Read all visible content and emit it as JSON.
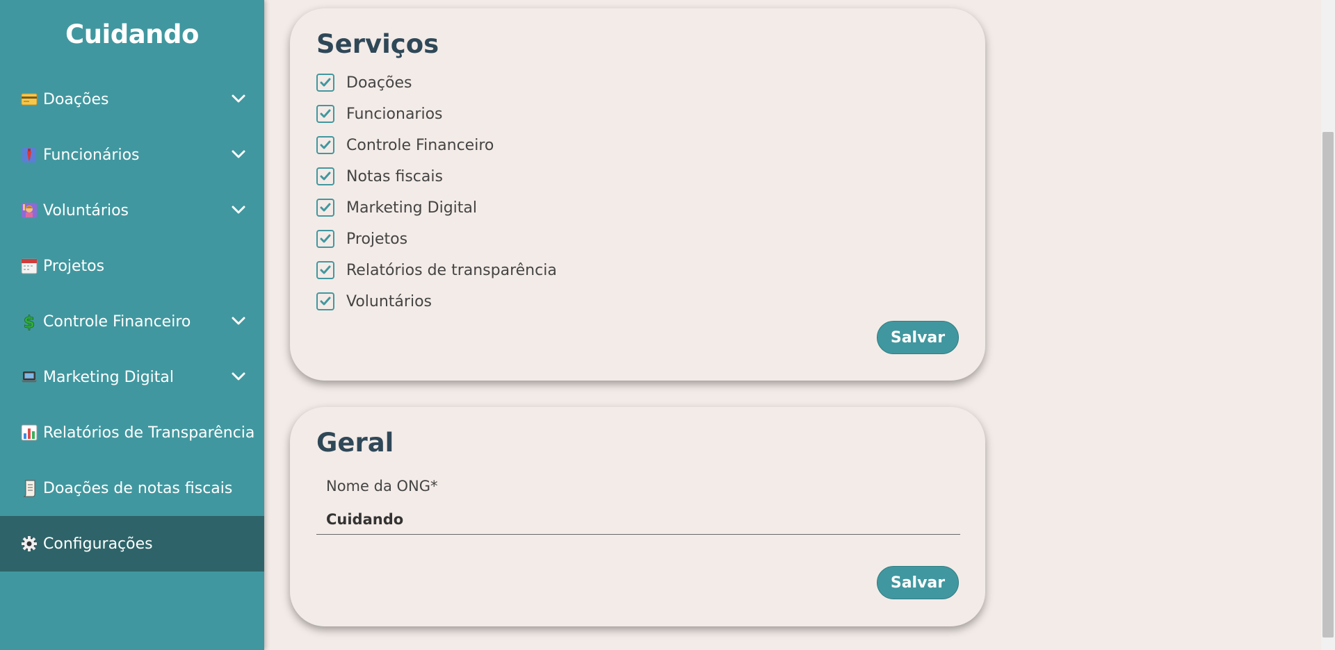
{
  "sidebar": {
    "brand": "Cuidando",
    "items": [
      {
        "label": "Doações",
        "icon": "credit-card-icon",
        "expandable": true
      },
      {
        "label": "Funcionários",
        "icon": "necktie-icon",
        "expandable": true
      },
      {
        "label": "Voluntários",
        "icon": "raising-hand-person-icon",
        "expandable": true
      },
      {
        "label": "Projetos",
        "icon": "calendar-icon",
        "expandable": false
      },
      {
        "label": "Controle Financeiro",
        "icon": "dollar-sign-icon",
        "expandable": true
      },
      {
        "label": "Marketing Digital",
        "icon": "laptop-icon",
        "expandable": true
      },
      {
        "label": "Relatórios de Transparência",
        "icon": "bar-chart-icon",
        "expandable": false
      },
      {
        "label": "Doações de notas fiscais",
        "icon": "receipt-scroll-icon",
        "expandable": false
      },
      {
        "label": "Configurações",
        "icon": "gear-icon",
        "expandable": false,
        "active": true
      }
    ]
  },
  "services": {
    "title": "Serviços",
    "items": [
      {
        "label": "Doações",
        "checked": true
      },
      {
        "label": "Funcionarios",
        "checked": true
      },
      {
        "label": "Controle Financeiro",
        "checked": true
      },
      {
        "label": "Notas fiscais",
        "checked": true
      },
      {
        "label": "Marketing Digital",
        "checked": true
      },
      {
        "label": "Projetos",
        "checked": true
      },
      {
        "label": "Relatórios de transparência",
        "checked": true
      },
      {
        "label": "Voluntários",
        "checked": true
      }
    ],
    "save_label": "Salvar"
  },
  "general": {
    "title": "Geral",
    "ong_name_label": "Nome da ONG*",
    "ong_name_value": "Cuidando",
    "save_label": "Salvar"
  },
  "colors": {
    "sidebar": "#41979f",
    "sidebar_active": "#2e6469",
    "background": "#f3ebe7",
    "title": "#2f4858",
    "button": "#41979f"
  }
}
